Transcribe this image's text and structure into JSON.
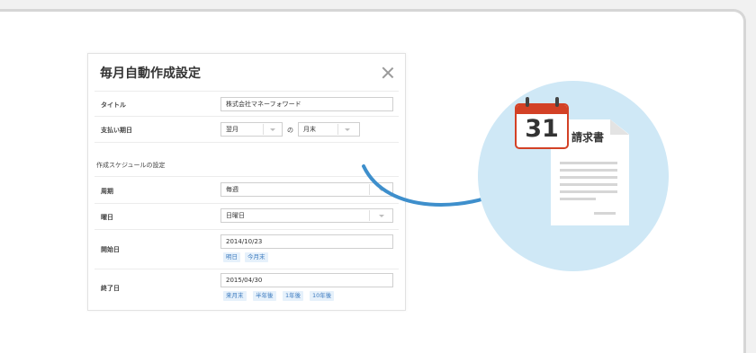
{
  "dialog": {
    "title": "毎月自動作成設定",
    "title_label": "タイトル",
    "title_value": "株式会社マネーフォワード",
    "due_label": "支払い期日",
    "due_month": "翌月",
    "due_of": "の",
    "due_day": "月末",
    "section_label": "作成スケジュールの設定",
    "cycle_label": "周期",
    "cycle_value": "毎週",
    "weekday_label": "曜日",
    "weekday_value": "日曜日",
    "start_label": "開始日",
    "start_value": "2014/10/23",
    "start_chips": [
      "明日",
      "今月末"
    ],
    "end_label": "終了日",
    "end_value": "2015/04/30",
    "end_chips": [
      "来月末",
      "半年後",
      "1年後",
      "10年後"
    ]
  },
  "illustration": {
    "calendar_day": "31",
    "document_title": "請求書",
    "accent_color": "#3e8fcc",
    "calendar_color": "#d34126",
    "circle_color": "#cfe8f6"
  }
}
